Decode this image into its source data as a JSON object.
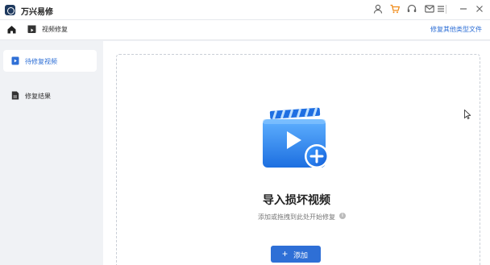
{
  "app": {
    "title": "万兴易修"
  },
  "titlebar": {
    "icons": [
      "user-icon",
      "cart-icon",
      "headset-icon",
      "mail-icon",
      "menu-icon",
      "minimize-icon",
      "close-icon"
    ]
  },
  "nav": {
    "title": "视频修复",
    "right_link": "修复其他类型文件"
  },
  "sidebar": {
    "items": [
      {
        "label": "待修复视频",
        "active": true
      },
      {
        "label": "修复结果",
        "active": false
      }
    ]
  },
  "dropzone": {
    "title": "导入损坏视频",
    "hint": "添加或拖拽到此处开始修复",
    "add_button": "添加"
  },
  "colors": {
    "accent": "#2e6fd6",
    "sidebar_bg": "#f0f2f5"
  }
}
